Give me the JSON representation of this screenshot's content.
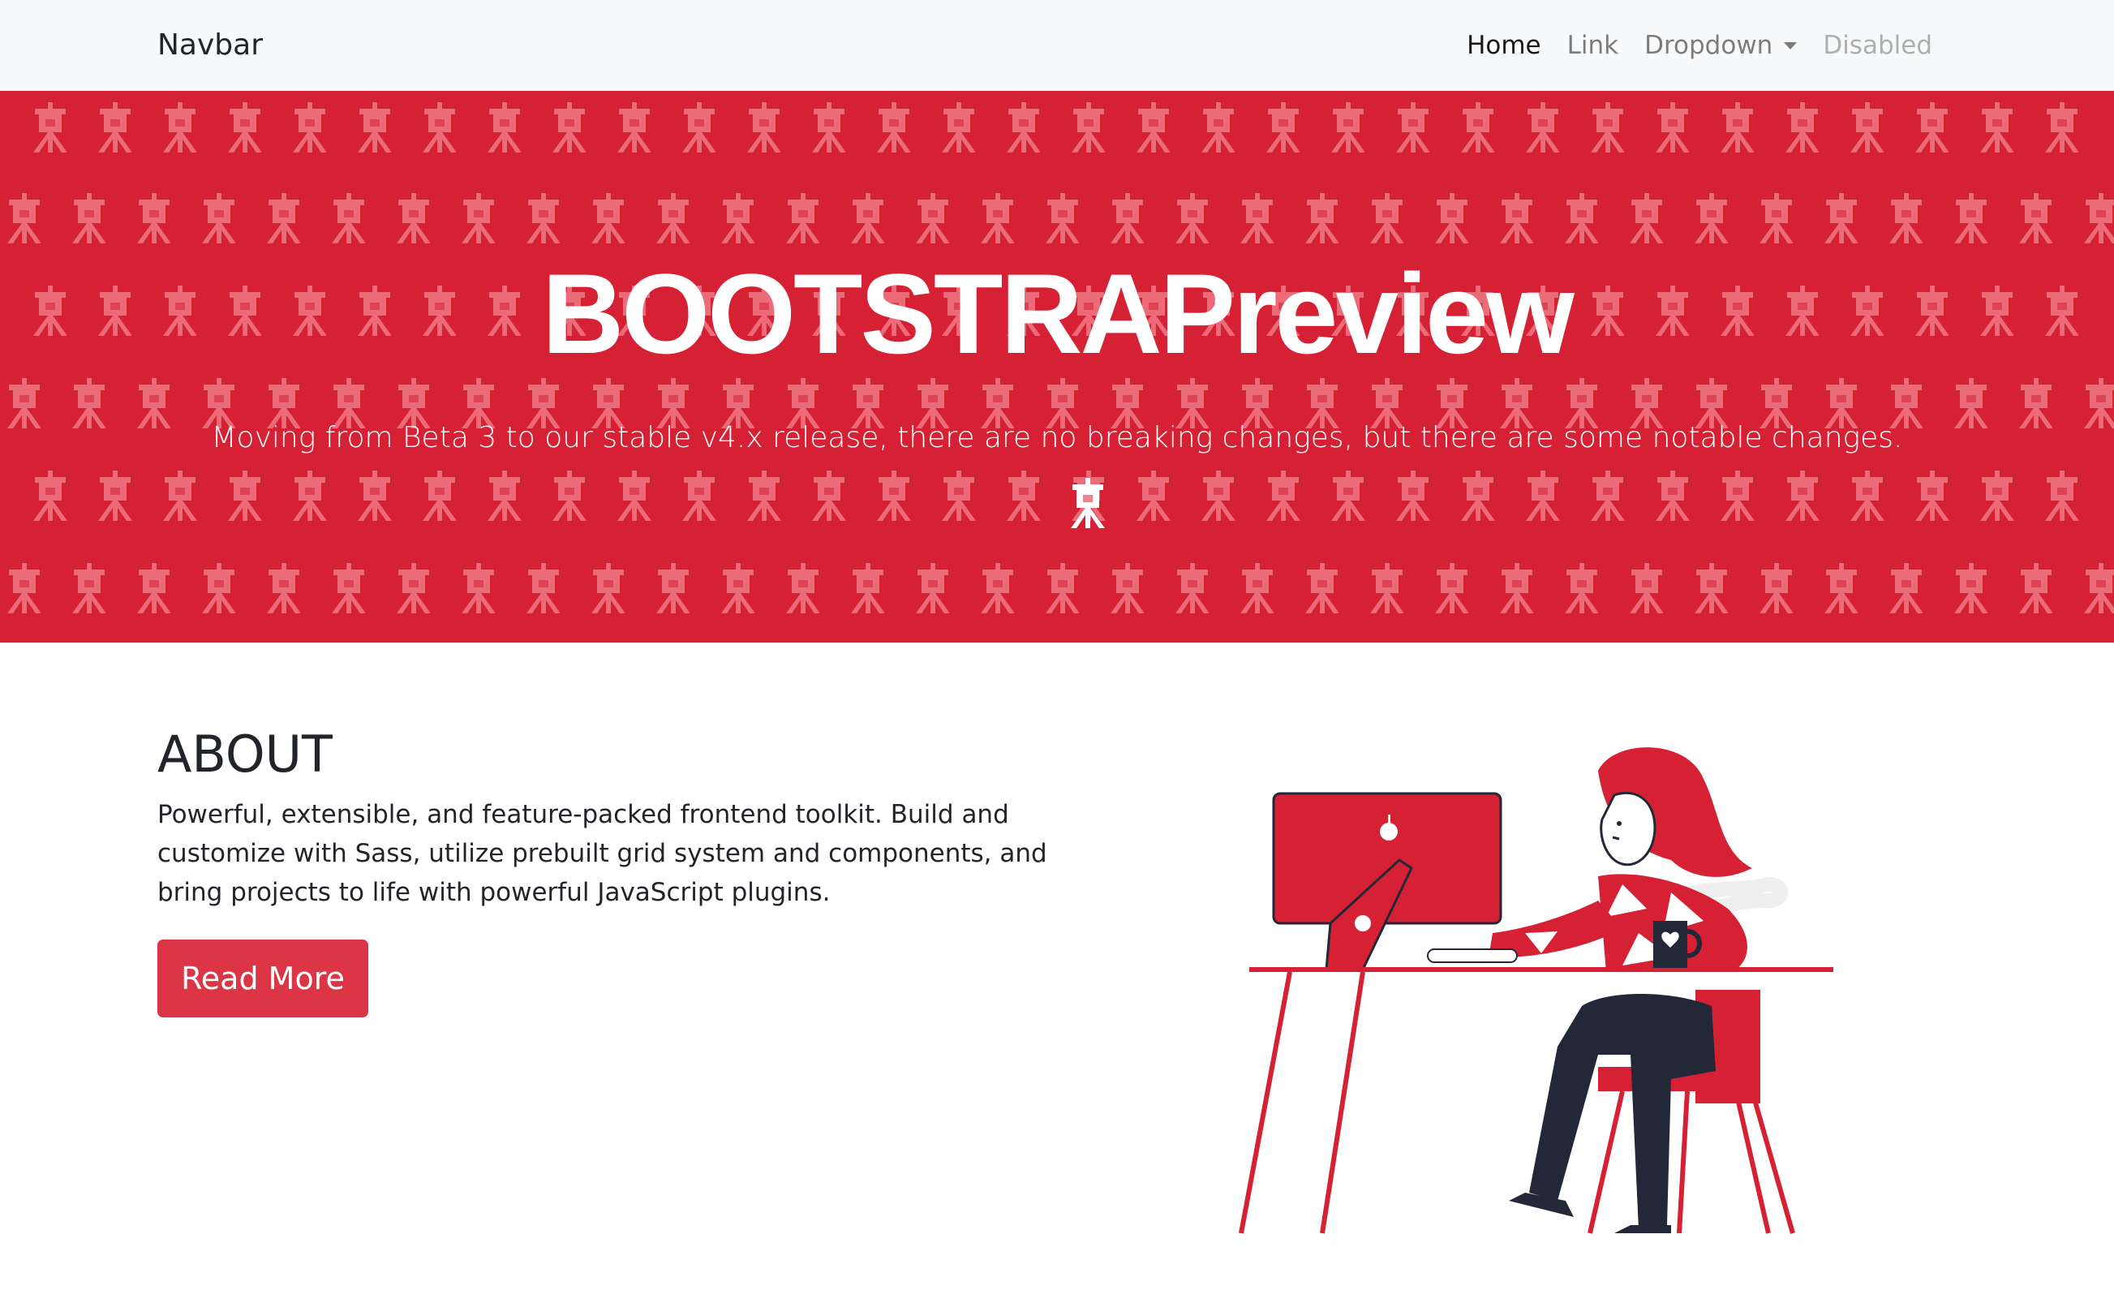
{
  "navbar": {
    "brand": "Navbar",
    "links": [
      {
        "label": "Home",
        "state": "active"
      },
      {
        "label": "Link",
        "state": "normal"
      },
      {
        "label": "Dropdown",
        "state": "dropdown"
      },
      {
        "label": "Disabled",
        "state": "disabled"
      }
    ]
  },
  "hero": {
    "title": "BOOTSTRAPreview",
    "subtitle": "Moving from Beta 3 to our stable v4.x release, there are no breaking changes, but there are some notable changes.",
    "background_color": "#d62033",
    "pattern_icon": "tripod-logo-icon"
  },
  "about": {
    "title": "ABOUT",
    "text": "Powerful, extensible, and feature-packed frontend toolkit. Build and customize with Sass, utilize prebuilt grid system and components, and bring projects to life with powerful JavaScript plugins.",
    "button_label": "Read More",
    "button_color": "#dc3545"
  },
  "illustration": {
    "icon": "person-at-computer-illustration"
  }
}
